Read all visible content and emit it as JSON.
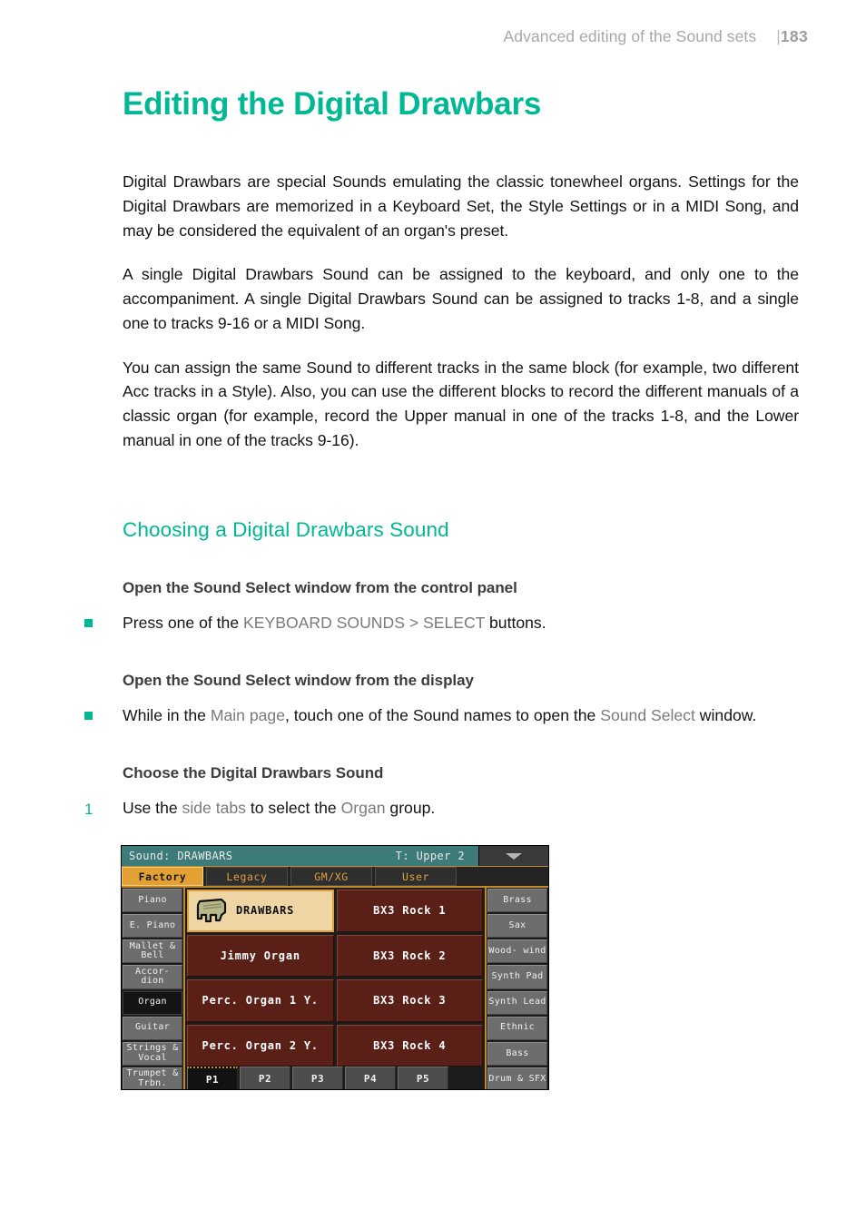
{
  "header": {
    "title": "Advanced editing of the Sound sets",
    "separator": "|",
    "page_number": "183"
  },
  "chapter": {
    "title": "Editing the Digital Drawbars",
    "paragraphs": [
      "Digital Drawbars are special Sounds emulating the classic tonewheel organs. Settings for the Digital Drawbars are memorized in a Keyboard Set, the Style Settings or in a MIDI Song, and may be considered the equivalent of an organ's preset.",
      "A single Digital Drawbars Sound can be assigned to the keyboard, and only one to the accompaniment. A single Digital Drawbars Sound can be assigned to tracks 1-8, and a single one to tracks 9-16 or a MIDI Song.",
      "You can assign the same Sound to different tracks in the same block (for example, two different Acc tracks in a Style). Also, you can use the different blocks to record the different manuals of a classic organ (for example, record the Upper manual in one of the tracks 1-8, and the Lower manual in one of the tracks 9-16)."
    ]
  },
  "section": {
    "title": "Choosing a Digital Drawbars Sound",
    "procedures": [
      {
        "title": "Open the Sound Select window from the control panel",
        "step_prefix": "Press one of the ",
        "step_ref": "KEYBOARD SOUNDS > SELECT",
        "step_suffix": " buttons."
      },
      {
        "title": "Open the Sound Select window from the display",
        "step_prefix": "While in the ",
        "step_ref": "Main page",
        "step_mid": ", touch one of the Sound names to open the ",
        "step_ref2": "Sound Select",
        "step_suffix": " window."
      },
      {
        "title": "Choose the Digital Drawbars Sound",
        "number": "1",
        "step_prefix": "Use the ",
        "step_ref": "side tabs",
        "step_mid": " to select the ",
        "step_ref2": "Organ",
        "step_suffix": " group."
      }
    ]
  },
  "device_screenshot": {
    "titlebar": {
      "sound_label": "Sound: DRAWBARS",
      "track_label": "T: Upper 2",
      "dropdown_icon": "chevron-down-icon"
    },
    "source_tabs": [
      {
        "label": "Factory",
        "active": true
      },
      {
        "label": "Legacy",
        "active": false
      },
      {
        "label": "GM/XG",
        "active": false
      },
      {
        "label": "User",
        "active": false
      }
    ],
    "left_tabs": [
      {
        "label": "Piano",
        "active": false
      },
      {
        "label": "E. Piano",
        "active": false
      },
      {
        "label": "Mallet &\nBell",
        "active": false
      },
      {
        "label": "Accor-\ndion",
        "active": false
      },
      {
        "label": "Organ",
        "active": true
      },
      {
        "label": "Guitar",
        "active": false
      },
      {
        "label": "Strings\n& Vocal",
        "active": false
      },
      {
        "label": "Trumpet\n& Trbn.",
        "active": false
      }
    ],
    "right_tabs": [
      {
        "label": "Brass",
        "active": false
      },
      {
        "label": "Sax",
        "active": false
      },
      {
        "label": "Wood-\nwind",
        "active": false
      },
      {
        "label": "Synth\nPad",
        "active": false
      },
      {
        "label": "Synth\nLead",
        "active": false
      },
      {
        "label": "Ethnic",
        "active": false
      },
      {
        "label": "Bass",
        "active": false
      },
      {
        "label": "Drum &\nSFX",
        "active": false
      }
    ],
    "sounds": [
      {
        "label": "DRAWBARS",
        "selected": true,
        "icon": "organ-icon"
      },
      {
        "label": "BX3 Rock 1",
        "selected": false
      },
      {
        "label": "Jimmy Organ",
        "selected": false
      },
      {
        "label": "BX3 Rock 2",
        "selected": false
      },
      {
        "label": "Perc. Organ 1 Y.",
        "selected": false
      },
      {
        "label": "BX3 Rock 3",
        "selected": false
      },
      {
        "label": "Perc. Organ 2 Y.",
        "selected": false
      },
      {
        "label": "BX3 Rock 4",
        "selected": false
      }
    ],
    "page_tabs": [
      {
        "label": "P1",
        "active": true
      },
      {
        "label": "P2",
        "active": false
      },
      {
        "label": "P3",
        "active": false
      },
      {
        "label": "P4",
        "active": false
      },
      {
        "label": "P5",
        "active": false
      }
    ]
  },
  "colors": {
    "accent_teal": "#00b894",
    "device_titlebar": "#3d7b78",
    "device_tab_active": "#e3a133",
    "sound_button": "#5a2018",
    "sound_button_selected": "#f0d5a4"
  }
}
